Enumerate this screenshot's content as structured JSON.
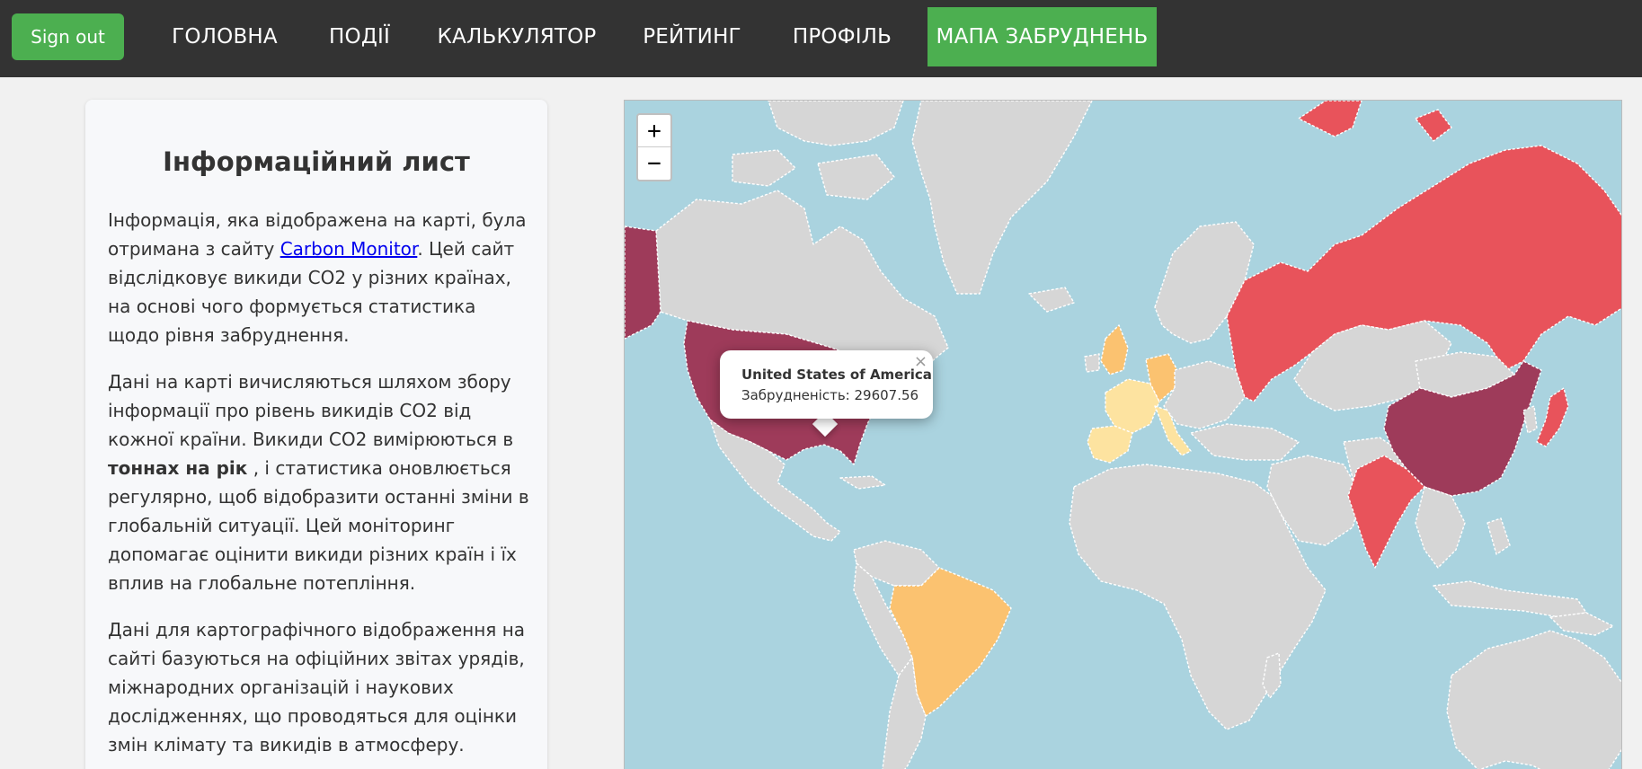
{
  "nav": {
    "signout_label": "Sign out",
    "items": [
      {
        "label": "ГОЛОВНА"
      },
      {
        "label": "ПОДІЇ"
      },
      {
        "label": "КАЛЬКУЛЯТОР"
      },
      {
        "label": "РЕЙТИНГ"
      },
      {
        "label": "ПРОФІЛЬ"
      },
      {
        "label": "МАПА ЗАБРУДНЕНЬ",
        "active": true
      }
    ]
  },
  "info": {
    "title": "Інформаційний лист",
    "p1_a": "Інформація, яка відображена на карті, була отримана з сайту ",
    "p1_link": "Carbon Monitor",
    "p1_b": ". Цей сайт відслідковує викиди CO2 у різних країнах, на основі чого формується статистика щодо рівня забруднення.",
    "p2_a": "Дані на карті вичисляються шляхом збору інформації про рівень викидів CO2 від кожної країни. Викиди CO2 вимірюються в ",
    "p2_bold": "тоннах на рік",
    "p2_b": " , і статистика оновлюється регулярно, щоб відобразити останні зміни в глобальній ситуації. Цей моніторинг допомагає оцінити викиди різних країн і їх вплив на глобальне потепління.",
    "p3": "Дані для картографічного відображення на сайті базуються на офіційних звітах урядів, міжнародних організацій і наукових дослідженнях, що проводяться для оцінки змін клімату та викидів в атмосферу."
  },
  "map": {
    "zoom_in": "+",
    "zoom_out": "−",
    "popup": {
      "title": "United States of America",
      "text": "Забрудненість: 29607.56",
      "close": "×"
    },
    "colors": {
      "water": "#aad3df",
      "land": "#d6d6d6",
      "very_high": "#9e3b5a",
      "high": "#e8535b",
      "medium": "#fbc270",
      "low": "#fde3a0"
    }
  }
}
